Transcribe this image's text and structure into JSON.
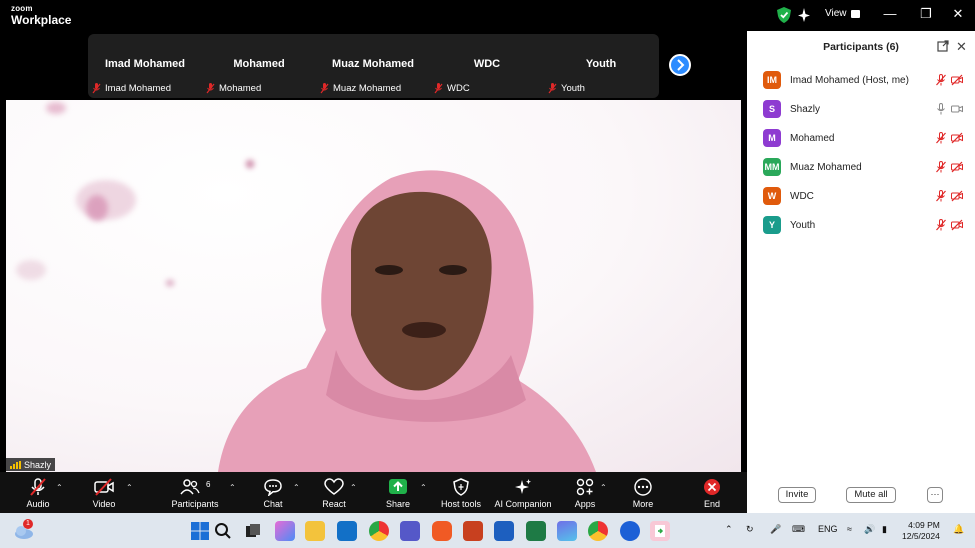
{
  "app": {
    "logo_small": "zoom",
    "logo_big": "Workplace",
    "view_label": "View"
  },
  "strip": {
    "thumbs": [
      {
        "name": "Imad Mohamed",
        "label": "Imad Mohamed"
      },
      {
        "name": "Mohamed",
        "label": "Mohamed"
      },
      {
        "name": "Muaz Mohamed",
        "label": "Muaz Mohamed"
      },
      {
        "name": "WDC",
        "label": "WDC"
      },
      {
        "name": "Youth",
        "label": "Youth"
      }
    ]
  },
  "video": {
    "speaker": "Shazly"
  },
  "participants": {
    "title": "Participants (6)",
    "list": [
      {
        "initials": "IM",
        "name": "Imad Mohamed (Host, me)",
        "color": "#e05a0c",
        "muted": true,
        "video_off": true
      },
      {
        "initials": "S",
        "name": "Shazly",
        "color": "#8e3bd1",
        "muted": false,
        "video_off": false
      },
      {
        "initials": "M",
        "name": "Mohamed",
        "color": "#8e3bd1",
        "muted": true,
        "video_off": true
      },
      {
        "initials": "MM",
        "name": "Muaz Mohamed",
        "color": "#2aa85a",
        "muted": true,
        "video_off": true
      },
      {
        "initials": "W",
        "name": "WDC",
        "color": "#e05a0c",
        "muted": true,
        "video_off": true
      },
      {
        "initials": "Y",
        "name": "Youth",
        "color": "#1a9c8c",
        "muted": true,
        "video_off": true
      }
    ],
    "invite": "Invite",
    "mute_all": "Mute all",
    "more": "···"
  },
  "toolbar": {
    "audio": "Audio",
    "video": "Video",
    "participants": "Participants",
    "participants_count": "6",
    "chat": "Chat",
    "react": "React",
    "share": "Share",
    "host_tools": "Host tools",
    "ai_companion": "AI Companion",
    "apps": "Apps",
    "more": "More",
    "end": "End"
  },
  "taskbar": {
    "weather_badge": "1",
    "language": "ENG",
    "time": "4:09 PM",
    "date": "12/5/2024"
  }
}
